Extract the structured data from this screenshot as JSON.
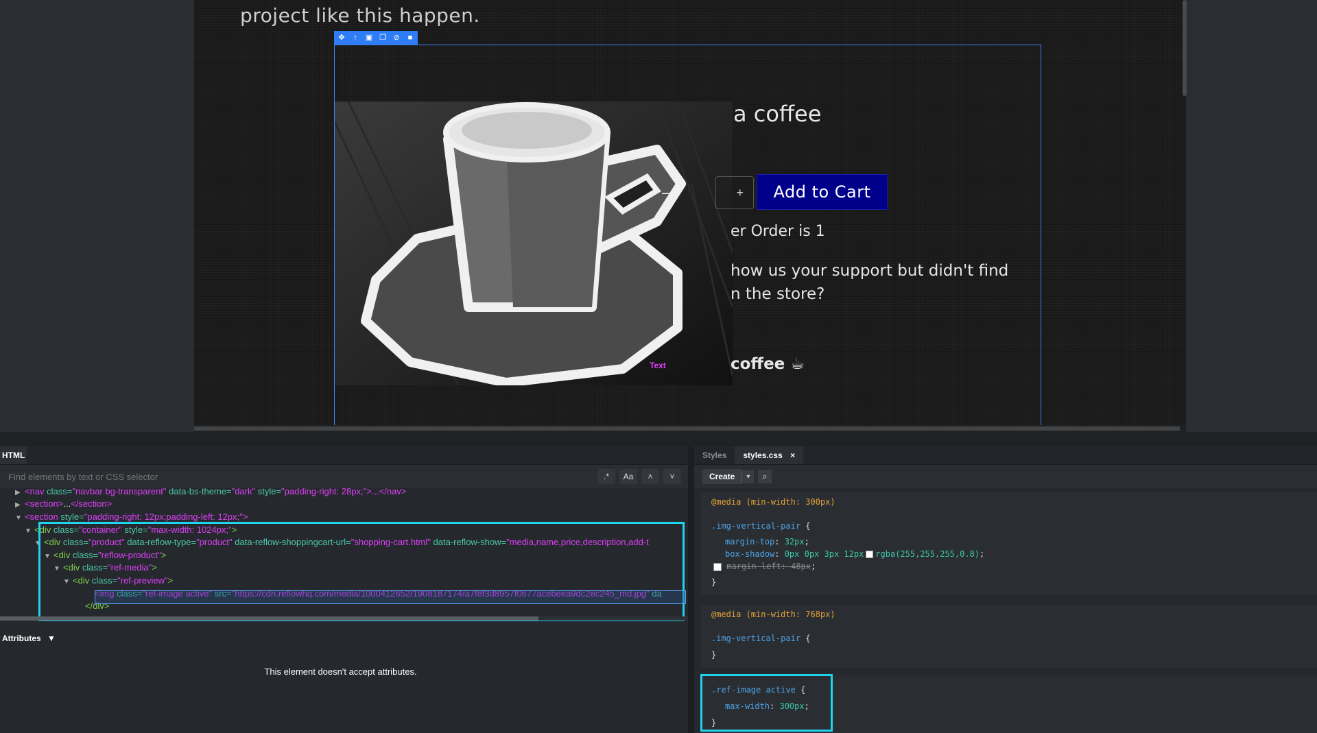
{
  "canvas": {
    "intro_text": "project like this happen.",
    "title_text": "a coffee",
    "stepper_plus": "+",
    "add_to_cart": "Add to Cart",
    "min_order": "er Order is 1",
    "support_line1": "how us your support but didn't find",
    "support_line2": "n the store?",
    "coffee_label": "coffee ☕",
    "image_badge": "Text",
    "image_minus": "−"
  },
  "html_panel": {
    "tab": "HTML",
    "search_placeholder": "Find elements by text or CSS selector",
    "search_btns": [
      ".*",
      "Aa",
      "˄",
      "˅"
    ],
    "tree": [
      {
        "arrow": "▶",
        "parts": [
          [
            "tag",
            "<nav "
          ],
          [
            "attr-name",
            "class="
          ],
          [
            "attr-val",
            "\"navbar bg-transparent\" "
          ],
          [
            "attr-name",
            "data-bs-theme="
          ],
          [
            "attr-val",
            "\"dark\" "
          ],
          [
            "attr-name",
            "style="
          ],
          [
            "attr-val",
            "\"padding-right: 28px;\""
          ],
          [
            "tag",
            ">...</nav>"
          ]
        ]
      },
      {
        "arrow": "▶",
        "parts": [
          [
            "tag",
            "<section>"
          ],
          [
            "punc",
            "..."
          ],
          [
            "tag",
            "</section>"
          ]
        ]
      },
      {
        "arrow": "▼",
        "parts": [
          [
            "tag",
            "<section "
          ],
          [
            "attr-name",
            "style="
          ],
          [
            "attr-val",
            "\"padding-right: 12px;padding-left: 12px;\""
          ],
          [
            "tag",
            ">"
          ]
        ]
      },
      {
        "arrow": "▼",
        "parts": [
          [
            "tag-green",
            "<div "
          ],
          [
            "attr-name",
            "class="
          ],
          [
            "attr-val",
            "\"container\" "
          ],
          [
            "attr-name",
            "style="
          ],
          [
            "attr-val",
            "\"max-width: 1024px;\""
          ],
          [
            "tag-green",
            ">"
          ]
        ]
      },
      {
        "arrow": "▼",
        "parts": [
          [
            "tag-green",
            "<div "
          ],
          [
            "attr-name",
            "class="
          ],
          [
            "attr-val",
            "\"product\" "
          ],
          [
            "attr-name",
            "data-reflow-type="
          ],
          [
            "attr-val",
            "\"product\" "
          ],
          [
            "attr-name",
            "data-reflow-shoppingcart-url="
          ],
          [
            "attr-val",
            "\"shopping-cart.html\" "
          ],
          [
            "attr-name",
            "data-reflow-show="
          ],
          [
            "attr-val",
            "\"media,name,price,description,add-t"
          ]
        ]
      },
      {
        "arrow": "▼",
        "parts": [
          [
            "tag-green",
            "<div "
          ],
          [
            "attr-name",
            "class="
          ],
          [
            "attr-val",
            "\"reflow-product\""
          ],
          [
            "tag-green",
            ">"
          ]
        ]
      },
      {
        "arrow": "▼",
        "parts": [
          [
            "tag-green",
            "<div "
          ],
          [
            "attr-name",
            "class="
          ],
          [
            "attr-val",
            "\"ref-media\""
          ],
          [
            "tag-green",
            ">"
          ]
        ]
      },
      {
        "arrow": "▼",
        "parts": [
          [
            "tag-green",
            "<div "
          ],
          [
            "attr-name",
            "class="
          ],
          [
            "attr-val",
            "\"ref-preview\""
          ],
          [
            "tag-green",
            ">"
          ]
        ]
      },
      {
        "arrow": "",
        "parts": [
          [
            "tag",
            "<img "
          ],
          [
            "attr-name",
            "class="
          ],
          [
            "attr-val",
            "\"ref-image active\" "
          ],
          [
            "attr-name",
            "src="
          ],
          [
            "attr-val",
            "\"https://cdn.reflowhq.com/media/1000412652/1908187174/a7f8f3d8957f0677acebeea9dc2ec245_md.jpg\" "
          ],
          [
            "attr-name",
            "da"
          ]
        ]
      },
      {
        "arrow": "",
        "parts": [
          [
            "tag-green",
            "</div>"
          ]
        ]
      }
    ],
    "attributes_label": "Attributes",
    "attributes_message": "This element doesn't accept attributes."
  },
  "css_panel": {
    "tabs": [
      "Styles",
      "styles.css"
    ],
    "tab_close": "×",
    "create_label": "Create",
    "create_dropdown": "▾",
    "search_icon": "⌕",
    "rules": [
      {
        "media": "@media (min-width: 300px)",
        "selector": ".img-vertical-pair",
        "decls": [
          {
            "prop": "margin-top",
            "val": "32px"
          },
          {
            "prop": "box-shadow",
            "val": "0px 0px 3px 12px",
            "color": "rgba(255,255,255,0.8)"
          },
          {
            "prop": "margin-left",
            "val": "48px",
            "disabled": true
          }
        ]
      },
      {
        "media": "@media (min-width: 768px)",
        "selector": ".img-vertical-pair",
        "decls": []
      },
      {
        "media": "",
        "selector": ".ref-image active",
        "decls": [
          {
            "prop": "max-width",
            "val": "300px"
          }
        ]
      }
    ]
  },
  "colors": {
    "accent_blue": "#3b82f6",
    "highlight_cyan": "#22d3ee",
    "cart_button": "#00008a",
    "badge_magenta": "#e040fb"
  }
}
